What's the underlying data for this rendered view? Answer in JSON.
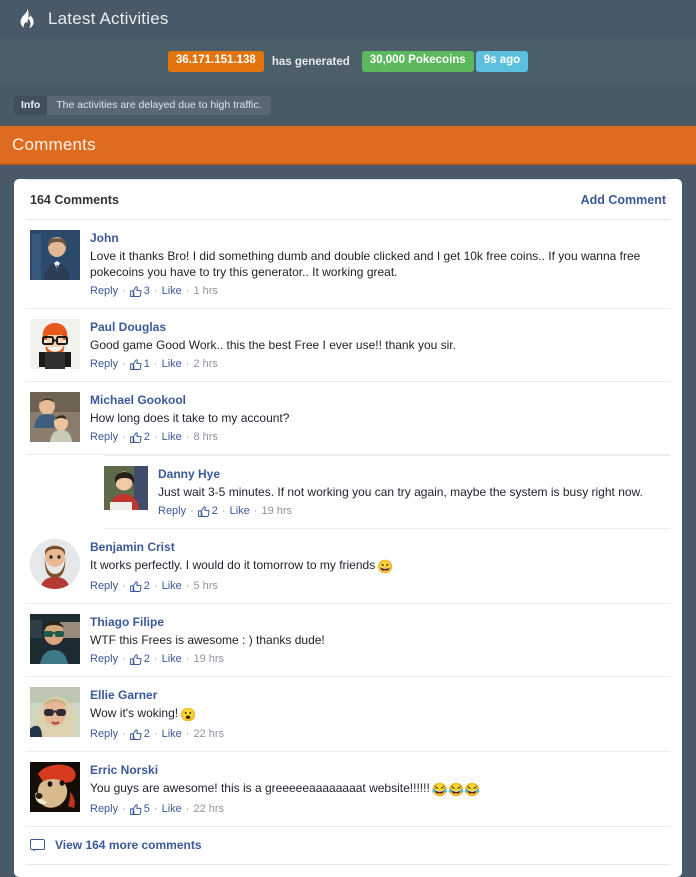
{
  "header": {
    "icon": "flame-icon",
    "title": "Latest Activities"
  },
  "activity": {
    "ip": "36.171.151.138",
    "middle_text": "has generated",
    "amount": "30,000 Pokecoins",
    "time": "9s ago",
    "colors": {
      "ip_badge": "#e2740e",
      "amount_badge": "#5cb85c",
      "time_badge": "#5bc0de"
    }
  },
  "info": {
    "label": "Info",
    "message": "The activities are delayed due to high traffic."
  },
  "comments_banner": {
    "title": "Comments",
    "color": "#dd6b20"
  },
  "comments_panel": {
    "count_label": "164 Comments",
    "add_comment_label": "Add Comment",
    "link_color": "#3b5998",
    "view_more_label": "View 164 more comments",
    "view_more_icon": "comment-bubble-icon",
    "actions": {
      "reply": "Reply",
      "like": "Like",
      "separator": "·",
      "thumb_icon": "thumbs-up-icon"
    },
    "comments": [
      {
        "author": "John",
        "text": "Love it thanks Bro! I did something dumb and double clicked and I get 10k free coins.. If you wanna free pokecoins you have to try this generator.. It working great.",
        "likes": "3",
        "time": "1 hrs",
        "avatar": "avatar-john"
      },
      {
        "author": "Paul Douglas",
        "text": "Good game Good Work.. this the best Free I ever use!! thank you sir.",
        "likes": "1",
        "time": "2 hrs",
        "avatar": "avatar-paul-douglas"
      },
      {
        "author": "Michael Gookool",
        "text": "How long does it take to my account?",
        "likes": "2",
        "time": "8 hrs",
        "avatar": "avatar-michael-gookool",
        "replies": [
          {
            "author": "Danny Hye",
            "text": "Just wait 3-5 minutes. If not working you can try again, maybe the system is busy right now.",
            "likes": "2",
            "time": "19 hrs",
            "avatar": "avatar-danny-hye"
          }
        ]
      },
      {
        "author": "Benjamin Crist",
        "text": "It works perfectly. I would do it tomorrow to my friends",
        "emoji": "😀",
        "likes": "2",
        "time": "5 hrs",
        "avatar": "avatar-benjamin-crist"
      },
      {
        "author": "Thiago Filipe",
        "text": "WTF this Frees is awesome : ) thanks dude!",
        "likes": "2",
        "time": "19 hrs",
        "avatar": "avatar-thiago-filipe"
      },
      {
        "author": "Ellie Garner",
        "text": "Wow it's woking!",
        "emoji": "😮",
        "likes": "2",
        "time": "22 hrs",
        "avatar": "avatar-ellie-garner"
      },
      {
        "author": "Erric Norski",
        "text": "You guys are awesome! this is a greeeeeaaaaaaaat website!!!!!!",
        "emoji": "😂😂😂",
        "likes": "5",
        "time": "22 hrs",
        "avatar": "avatar-erric-norski"
      }
    ]
  }
}
